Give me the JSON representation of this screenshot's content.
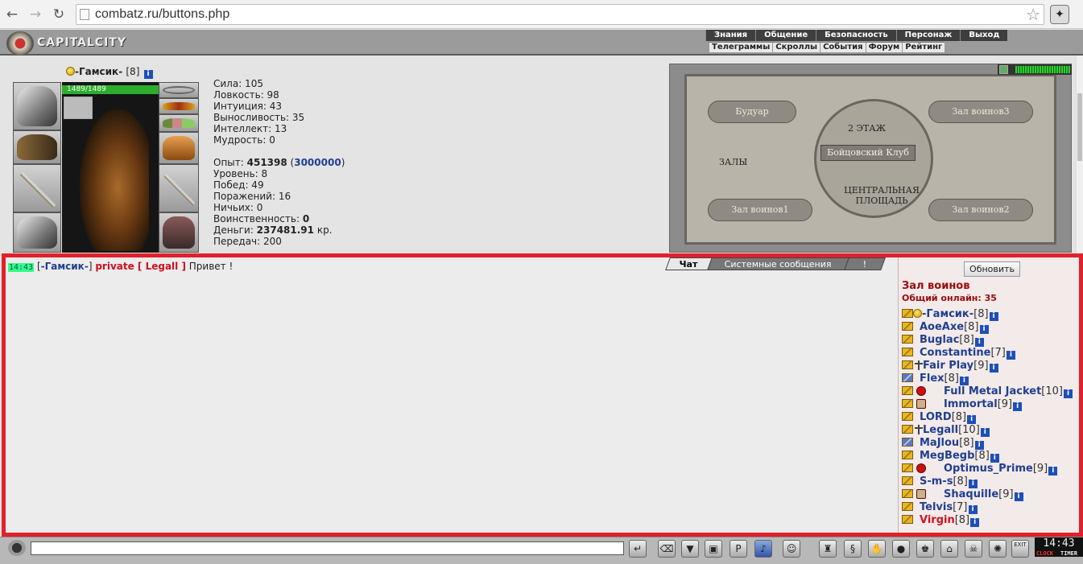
{
  "browser": {
    "url": "combatz.ru/buttons.php"
  },
  "header": {
    "logo_text": "CAPITALCITY",
    "top_menu": [
      "Знания",
      "Общение",
      "Безопасность",
      "Персонаж",
      "Выход"
    ],
    "sub_menu": [
      "Телеграммы",
      "Скроллы",
      "События",
      "Форум",
      "Рейтинг"
    ]
  },
  "character": {
    "name": "-Гамсик-",
    "level": "[8]",
    "hp": "1489/1489",
    "stats": {
      "strength": "Сила: 105",
      "agility": "Ловкость: 98",
      "intuition": "Интуиция: 43",
      "endurance": "Выносливость: 35",
      "intellect": "Интеллект: 13",
      "wisdom": "Мудрость: 0",
      "exp_label": "Опыт: ",
      "exp_value": "451398",
      "exp_next": "3000000",
      "level_label": "Уровень: 8",
      "wins": "Побед: 49",
      "losses": "Поражений: 16",
      "draws": "Ничьих: 0",
      "valor_label": "Воинственность: ",
      "valor_value": "0",
      "money_label": "Деньги: ",
      "money_value": "237481.91",
      "money_unit": " кр.",
      "transfers": "Передач: 200"
    }
  },
  "map": {
    "rooms": {
      "boudoir": "Будуар",
      "warriors3": "Зал воинов3",
      "floor": "2 ЭТАЖ",
      "club": "Бойцовский Клуб",
      "halls": "ЗАЛЫ",
      "square": "ЦЕНТРАЛЬНАЯ ПЛОЩАДЬ",
      "warriors1": "Зал воинов1",
      "warriors2": "Зал воинов2"
    }
  },
  "chat": {
    "tabs": [
      "Чат",
      "Системные сообщения",
      "!"
    ],
    "message": {
      "time": "14:43",
      "open_bracket": "[",
      "author": "-Гамсик-",
      "close_bracket": "]",
      "private": "private [ Legall ]",
      "text": "Привет !"
    }
  },
  "online": {
    "refresh_label": "Обновить",
    "room": "Зал воинов",
    "count": "Общий онлайн: 35",
    "users": [
      {
        "name": "-Гамсик-",
        "level": "[8]"
      },
      {
        "name": "AoeAxe",
        "level": "[8]"
      },
      {
        "name": "Buglac",
        "level": "[8]"
      },
      {
        "name": "Constantine",
        "level": "[7]"
      },
      {
        "name": "Fair Play",
        "level": "[9]"
      },
      {
        "name": "Flex",
        "level": "[8]"
      },
      {
        "name": "Full Metal Jacket",
        "level": "[10]"
      },
      {
        "name": "Immortal",
        "level": "[9]"
      },
      {
        "name": "LORD",
        "level": "[8]"
      },
      {
        "name": "Legall",
        "level": "[10]"
      },
      {
        "name": "MaJlou",
        "level": "[8]"
      },
      {
        "name": "MegBegb",
        "level": "[8]"
      },
      {
        "name": "Optimus_Prime",
        "level": "[9]"
      },
      {
        "name": "S-m-s",
        "level": "[8]"
      },
      {
        "name": "Shaquille",
        "level": "[9]"
      },
      {
        "name": "Telvis",
        "level": "[7]"
      },
      {
        "name": "Virgin",
        "level": "[8]"
      }
    ]
  },
  "bottom": {
    "clock": "14:43",
    "clock_label": "CLOCK",
    "timer_label": "TIMER",
    "exit_label": "EXIT"
  }
}
